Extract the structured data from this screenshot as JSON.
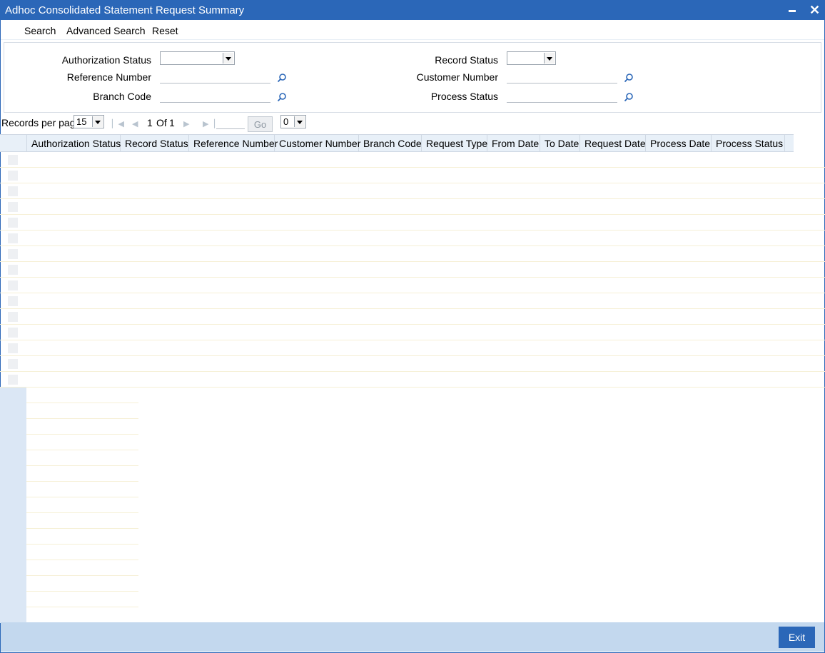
{
  "window": {
    "title": "Adhoc Consolidated Statement Request Summary"
  },
  "menu": {
    "search": "Search",
    "advanced_search": "Advanced Search",
    "reset": "Reset"
  },
  "criteria": {
    "authorization_status": {
      "label": "Authorization Status",
      "value": ""
    },
    "record_status": {
      "label": "Record Status",
      "value": ""
    },
    "reference_number": {
      "label": "Reference Number",
      "value": ""
    },
    "customer_number": {
      "label": "Customer Number",
      "value": ""
    },
    "branch_code": {
      "label": "Branch Code",
      "value": ""
    },
    "process_status": {
      "label": "Process Status",
      "value": ""
    }
  },
  "pager": {
    "records_per_page_label": "Records per page",
    "records_per_page": "15",
    "current_page": "1",
    "of_label": "Of",
    "total_pages": "1",
    "go_label": "Go",
    "goto_value": "0"
  },
  "grid": {
    "columns": [
      "Authorization Status",
      "Record Status",
      "Reference Number",
      "Customer Number",
      "Branch Code",
      "Request Type",
      "From Date",
      "To Date",
      "Request Date",
      "Process Date",
      "Process Status"
    ]
  },
  "footer": {
    "exit_label": "Exit"
  },
  "colors": {
    "title_bar": "#2b67b8",
    "footer": "#c3d8ee",
    "header_row": "#e8f0f8"
  },
  "icons": {
    "lookup": "magnifier-icon",
    "first": "first-page-icon",
    "prev": "prev-page-icon",
    "next": "next-page-icon",
    "last": "last-page-icon"
  }
}
